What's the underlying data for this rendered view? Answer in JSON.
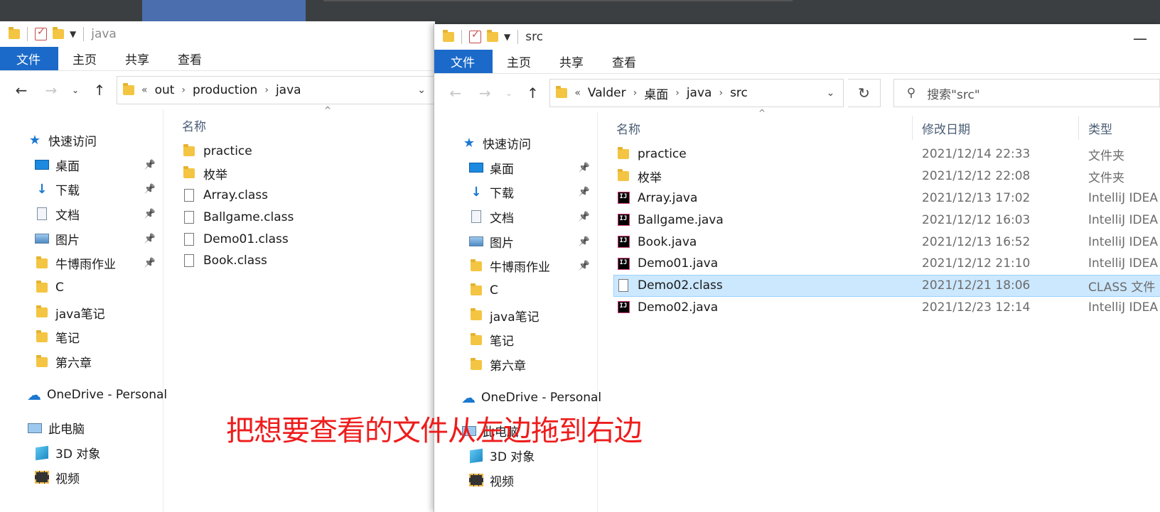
{
  "left": {
    "title": "java",
    "ribbon": [
      "文件",
      "主页",
      "共享",
      "查看"
    ],
    "path": [
      "out",
      "production",
      "java"
    ],
    "col_name": "名称",
    "sidebar": [
      {
        "label": "快速访问",
        "icon": "star-icon",
        "level": 0,
        "pin": false
      },
      {
        "label": "桌面",
        "icon": "desktop-icon",
        "level": 1,
        "pin": true
      },
      {
        "label": "下载",
        "icon": "download-icon",
        "level": 1,
        "pin": true
      },
      {
        "label": "文档",
        "icon": "document-icon",
        "level": 1,
        "pin": true
      },
      {
        "label": "图片",
        "icon": "picture-icon",
        "level": 1,
        "pin": true
      },
      {
        "label": "牛博雨作业",
        "icon": "folder-icon",
        "level": 1,
        "pin": true
      },
      {
        "label": "C",
        "icon": "folder-icon",
        "level": 1,
        "pin": false
      },
      {
        "label": "java笔记",
        "icon": "folder-icon",
        "level": 1,
        "pin": false
      },
      {
        "label": "笔记",
        "icon": "folder-icon",
        "level": 1,
        "pin": false
      },
      {
        "label": "第六章",
        "icon": "folder-icon",
        "level": 1,
        "pin": false
      },
      {
        "label": "OneDrive - Personal",
        "icon": "onedrive-icon",
        "level": 0,
        "pin": false
      },
      {
        "label": "此电脑",
        "icon": "pc-icon",
        "level": 0,
        "pin": false
      },
      {
        "label": "3D 对象",
        "icon": "3d-icon",
        "level": 1,
        "pin": false
      },
      {
        "label": "视频",
        "icon": "video-icon",
        "level": 1,
        "pin": false
      }
    ],
    "files": [
      {
        "name": "practice",
        "icon": "folder-icon"
      },
      {
        "name": "枚举",
        "icon": "folder-icon"
      },
      {
        "name": "Array.class",
        "icon": "file-icon"
      },
      {
        "name": "Ballgame.class",
        "icon": "file-icon"
      },
      {
        "name": "Demo01.class",
        "icon": "file-icon"
      },
      {
        "name": "Book.class",
        "icon": "file-icon"
      }
    ]
  },
  "right": {
    "title": "src",
    "ribbon": [
      "文件",
      "主页",
      "共享",
      "查看"
    ],
    "path": [
      "Valder",
      "桌面",
      "java",
      "src"
    ],
    "search_placeholder": "搜索\"src\"",
    "col_name": "名称",
    "col_date": "修改日期",
    "col_type": "类型",
    "sidebar": [
      {
        "label": "快速访问",
        "icon": "star-icon",
        "level": 0,
        "pin": false
      },
      {
        "label": "桌面",
        "icon": "desktop-icon",
        "level": 1,
        "pin": true
      },
      {
        "label": "下载",
        "icon": "download-icon",
        "level": 1,
        "pin": true
      },
      {
        "label": "文档",
        "icon": "document-icon",
        "level": 1,
        "pin": true
      },
      {
        "label": "图片",
        "icon": "picture-icon",
        "level": 1,
        "pin": true
      },
      {
        "label": "牛博雨作业",
        "icon": "folder-icon",
        "level": 1,
        "pin": true
      },
      {
        "label": "C",
        "icon": "folder-icon",
        "level": 1,
        "pin": false
      },
      {
        "label": "java笔记",
        "icon": "folder-icon",
        "level": 1,
        "pin": false
      },
      {
        "label": "笔记",
        "icon": "folder-icon",
        "level": 1,
        "pin": false
      },
      {
        "label": "第六章",
        "icon": "folder-icon",
        "level": 1,
        "pin": false
      },
      {
        "label": "OneDrive - Personal",
        "icon": "onedrive-icon",
        "level": 0,
        "pin": false
      },
      {
        "label": "此电脑",
        "icon": "pc-icon",
        "level": 0,
        "pin": false
      },
      {
        "label": "3D 对象",
        "icon": "3d-icon",
        "level": 1,
        "pin": false
      },
      {
        "label": "视频",
        "icon": "video-icon",
        "level": 1,
        "pin": false
      }
    ],
    "files": [
      {
        "name": "practice",
        "icon": "folder-icon",
        "date": "2021/12/14 22:33",
        "type": "文件夹",
        "selected": false
      },
      {
        "name": "枚举",
        "icon": "folder-icon",
        "date": "2021/12/12 22:08",
        "type": "文件夹",
        "selected": false
      },
      {
        "name": "Array.java",
        "icon": "intellij-icon",
        "date": "2021/12/13 17:02",
        "type": "IntelliJ IDEA",
        "selected": false
      },
      {
        "name": "Ballgame.java",
        "icon": "intellij-icon",
        "date": "2021/12/12 16:03",
        "type": "IntelliJ IDEA",
        "selected": false
      },
      {
        "name": "Book.java",
        "icon": "intellij-icon",
        "date": "2021/12/13 16:52",
        "type": "IntelliJ IDEA",
        "selected": false
      },
      {
        "name": "Demo01.java",
        "icon": "intellij-icon",
        "date": "2021/12/12 21:10",
        "type": "IntelliJ IDEA",
        "selected": false
      },
      {
        "name": "Demo02.class",
        "icon": "file-icon",
        "date": "2021/12/21 18:06",
        "type": "CLASS 文件",
        "selected": true
      },
      {
        "name": "Demo02.java",
        "icon": "intellij-icon",
        "date": "2021/12/23 12:14",
        "type": "IntelliJ IDEA",
        "selected": false
      }
    ]
  },
  "overlay_caption": "把想要查看的文件从左边拖到右边",
  "colors": {
    "accent": "#1b6ac9",
    "selection": "#cce8ff",
    "caption": "#ee1c1c"
  }
}
